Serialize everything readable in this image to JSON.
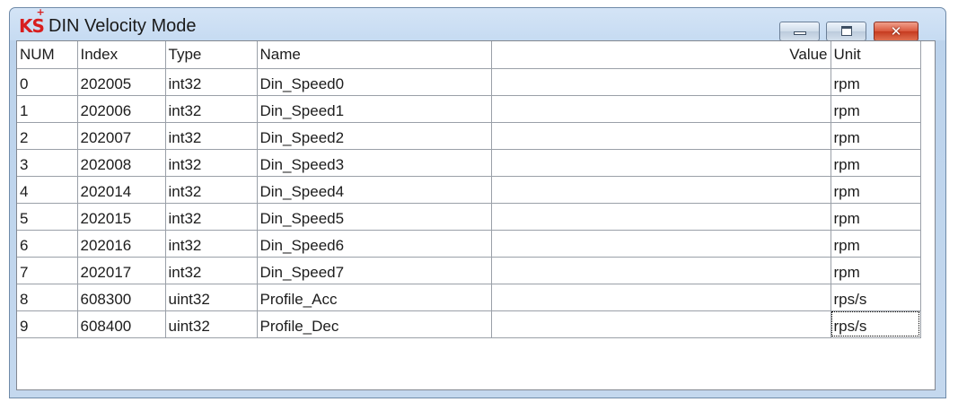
{
  "window": {
    "logo_text": "KS",
    "title": "DIN Velocity Mode"
  },
  "table": {
    "headers": [
      "NUM",
      "Index",
      "Type",
      "Name",
      "Value",
      "Unit"
    ],
    "rows": [
      {
        "num": "0",
        "index": "202005",
        "type": "int32",
        "name": "Din_Speed0",
        "value": "",
        "unit": "rpm"
      },
      {
        "num": "1",
        "index": "202006",
        "type": "int32",
        "name": "Din_Speed1",
        "value": "",
        "unit": "rpm"
      },
      {
        "num": "2",
        "index": "202007",
        "type": "int32",
        "name": "Din_Speed2",
        "value": "",
        "unit": "rpm"
      },
      {
        "num": "3",
        "index": "202008",
        "type": "int32",
        "name": "Din_Speed3",
        "value": "",
        "unit": "rpm"
      },
      {
        "num": "4",
        "index": "202014",
        "type": "int32",
        "name": "Din_Speed4",
        "value": "",
        "unit": "rpm"
      },
      {
        "num": "5",
        "index": "202015",
        "type": "int32",
        "name": "Din_Speed5",
        "value": "",
        "unit": "rpm"
      },
      {
        "num": "6",
        "index": "202016",
        "type": "int32",
        "name": "Din_Speed6",
        "value": "",
        "unit": "rpm"
      },
      {
        "num": "7",
        "index": "202017",
        "type": "int32",
        "name": "Din_Speed7",
        "value": "",
        "unit": "rpm"
      },
      {
        "num": "8",
        "index": "608300",
        "type": "uint32",
        "name": "Profile_Acc",
        "value": "",
        "unit": "rps/s"
      },
      {
        "num": "9",
        "index": "608400",
        "type": "uint32",
        "name": "Profile_Dec",
        "value": "",
        "unit": "rps/s"
      }
    ]
  }
}
